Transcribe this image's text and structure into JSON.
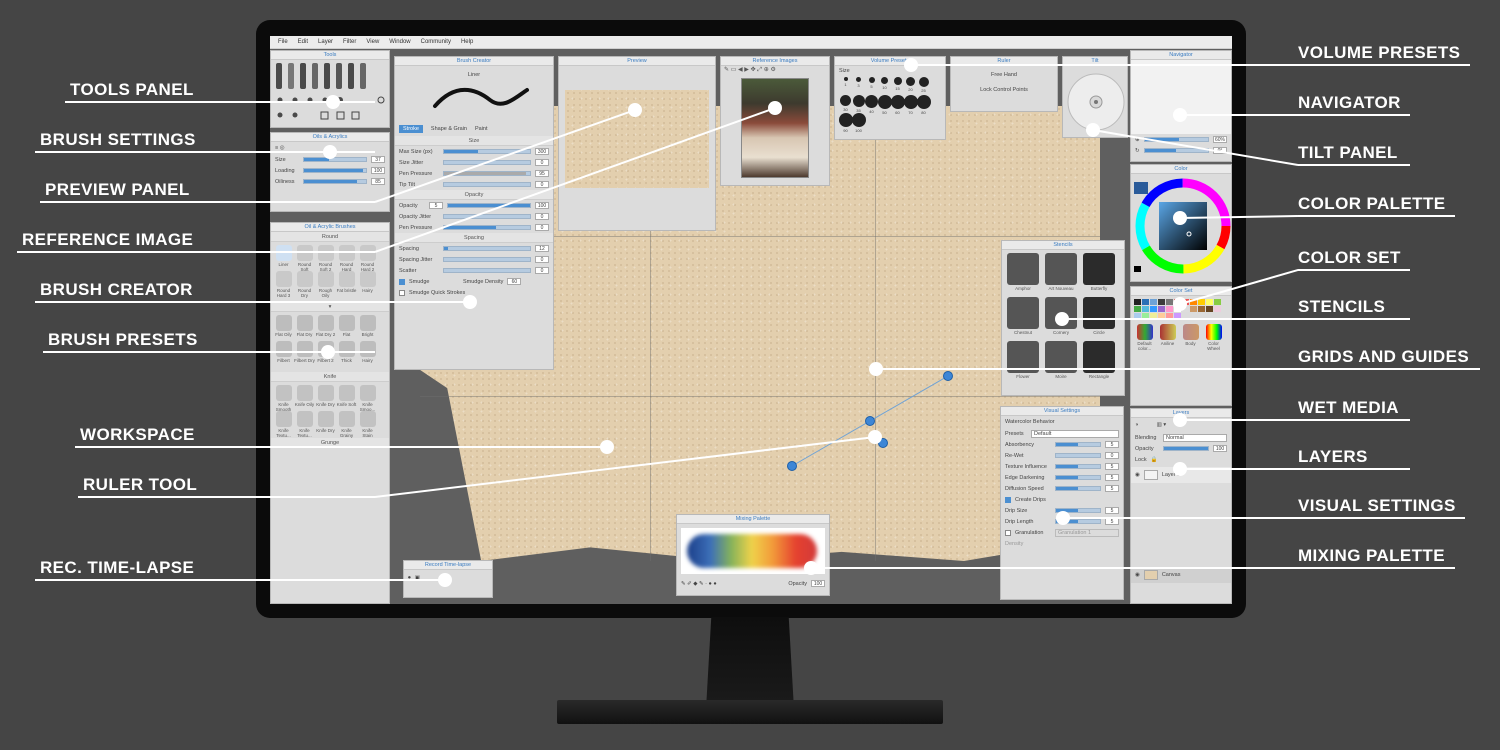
{
  "menu": [
    "File",
    "Edit",
    "Layer",
    "Filter",
    "View",
    "Window",
    "Community",
    "Help"
  ],
  "panels": {
    "tools": "Tools",
    "brush_settings": {
      "title": "Oils & Acrylics",
      "size_label": "Size",
      "size_value": "37",
      "loading_label": "Loading",
      "loading_value": "100",
      "oiliness_label": "Oiliness",
      "oiliness_value": "85"
    },
    "brushes": {
      "title": "Oil & Acrylic Brushes",
      "group1": "Round",
      "group2": "Knife",
      "group3": "Grunge",
      "round": [
        "Liner",
        "Round Soft",
        "Round Soft 2",
        "Round Hard",
        "Round Hard 2",
        "Round Hard 3",
        "Round Dry",
        "Rough Oily",
        "Fat bristle",
        "Hairy"
      ],
      "flat": [
        "Flat Oily",
        "Flat Dry",
        "Flat Dry 2",
        "Flat",
        "Bright",
        "Filbert",
        "Filbert Dry",
        "Filbert 2",
        "Thick",
        "Hairy"
      ],
      "knife": [
        "Knife Smooth",
        "Knife Oily",
        "Knife Dry",
        "Knife Soft",
        "Knife Smoo...",
        "Knife Textu...",
        "Knife Textu...",
        "Knife Dry",
        "Knife Grainy",
        "Knife Stain"
      ]
    },
    "brush_creator": {
      "title": "Brush Creator",
      "brush_name": "Liner",
      "tab_stroke": "Stroke",
      "tab_shape": "Shape & Grain",
      "tab_paint": "Paint",
      "size_section": "Size",
      "max_size_label": "Max Size (px)",
      "max_size_value": "300",
      "size_jitter_label": "Size Jitter",
      "size_jitter_value": "0",
      "pen_pressure_label": "Pen Pressure",
      "pen_pressure_value": "95",
      "tip_tilt_label": "Tip Tilt",
      "tip_tilt_value": "0",
      "opacity_section": "Opacity",
      "opacity_label": "Opacity",
      "opacity_min": "5",
      "opacity_value": "100",
      "opacity_jitter_label": "Opacity Jitter",
      "opacity_jitter_value": "0",
      "opacity_pressure_label": "Pen Pressure",
      "opacity_pressure_value": "0",
      "spacing_section": "Spacing",
      "spacing_label": "Spacing",
      "spacing_value": "12",
      "spacing_jitter_label": "Spacing Jitter",
      "spacing_jitter_value": "0",
      "scatter_label": "Scatter",
      "scatter_value": "0",
      "smudge_label": "Smudge",
      "smudge_density_label": "Smudge Density",
      "smudge_density_value": "60",
      "smudge_quick_label": "Smudge Quick Strokes"
    },
    "preview": "Preview",
    "reference": "Reference Images",
    "volume": {
      "title": "Volume Presets",
      "size_label": "Size",
      "sizes": [
        "1",
        "3",
        "5",
        "10",
        "15",
        "20",
        "25",
        "30",
        "35",
        "40",
        "50",
        "60",
        "70",
        "80",
        "90",
        "100"
      ]
    },
    "ruler": {
      "title": "Ruler",
      "free_hand": "Free Hand",
      "lock_points": "Lock Control Points"
    },
    "tilt": "Tilt",
    "navigator": {
      "title": "Navigator",
      "zoom": "60%",
      "rotation": "0°"
    },
    "color": "Color",
    "color_set": {
      "title": "Color Set",
      "sets": [
        "Default color...",
        "Aniline",
        "Body",
        "Color Wheel"
      ]
    },
    "stencils": {
      "title": "Stencils",
      "items": [
        "Amphor",
        "Art Nouveau",
        "Butterfly",
        "Chestnut",
        "Cornery",
        "Circle",
        "Flower",
        "Moire",
        "Rectangle"
      ]
    },
    "visual": {
      "title": "Visual Settings",
      "behavior": "Watercolor Behavior",
      "presets_label": "Presets",
      "presets_value": "Default",
      "rows": [
        {
          "label": "Absorbency",
          "value": "5"
        },
        {
          "label": "Re-Wet",
          "value": "0"
        },
        {
          "label": "Texture Influence",
          "value": "5"
        },
        {
          "label": "Edge Darkening",
          "value": "5"
        },
        {
          "label": "Diffusion Speed",
          "value": "5"
        }
      ],
      "create_drips": "Create Drips",
      "drip_size_label": "Drip Size",
      "drip_size_value": "5",
      "drip_length_label": "Drip Length",
      "drip_length_value": "5",
      "granulation_label": "Granulation",
      "granulation_value": "Granulation 1",
      "density_label": "Density"
    },
    "layers": {
      "title": "Layers",
      "blending_label": "Blending",
      "blending_value": "Normal",
      "opacity_label": "Opacity",
      "opacity_value": "100",
      "lock_label": "Lock",
      "layer1": "Layer 1",
      "canvas": "Canvas"
    },
    "mixing": {
      "title": "Mixing Palette",
      "opacity_label": "Opacity",
      "opacity_value": "100"
    },
    "timelapse": "Record Time-lapse"
  },
  "callouts": {
    "left": [
      "TOOLS PANEL",
      "BRUSH SETTINGS",
      "PREVIEW PANEL",
      "REFERENCE IMAGE",
      "BRUSH CREATOR",
      "BRUSH PRESETS",
      "WORKSPACE",
      "RULER TOOL",
      "REC. TIME-LAPSE"
    ],
    "right": [
      "VOLUME PRESETS",
      "NAVIGATOR",
      "TILT PANEL",
      "COLOR PALETTE",
      "COLOR SET",
      "STENCILS",
      "GRIDS AND GUIDES",
      "WET MEDIA",
      "LAYERS",
      "VISUAL SETTINGS",
      "MIXING PALETTE"
    ]
  },
  "colors": {
    "accent": "#3a7cc1",
    "background": "#454545",
    "paper": "#e3cfae"
  }
}
